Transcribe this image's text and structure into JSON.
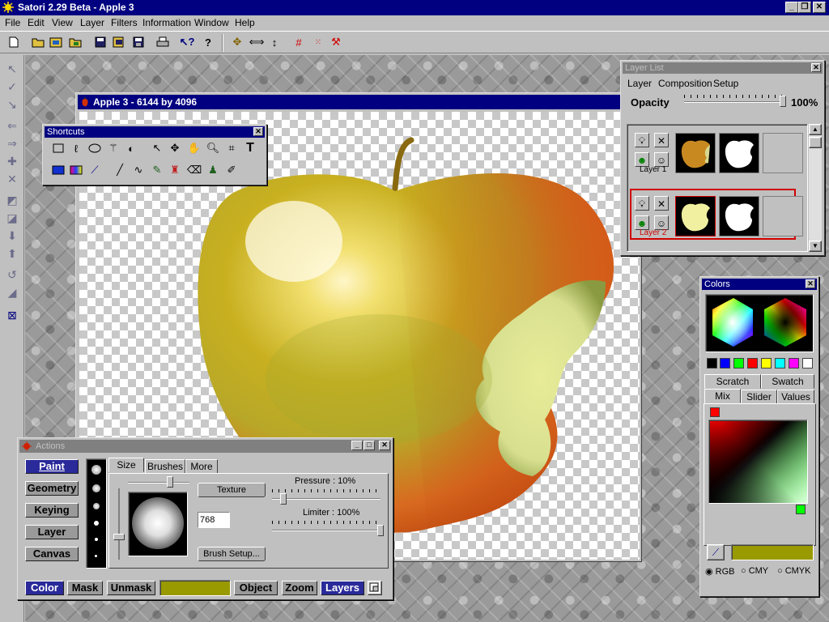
{
  "app": {
    "title": "Satori 2.29 Beta - Apple 3",
    "window_controls": [
      "_",
      "❐",
      "✕"
    ]
  },
  "menu": [
    "File",
    "Edit",
    "View",
    "Layer",
    "Filters",
    "Information",
    "Window",
    "Help"
  ],
  "document": {
    "title": "Apple 3 - 6144 by 4096"
  },
  "shortcuts": {
    "title": "Shortcuts"
  },
  "layer_list": {
    "title": "Layer List",
    "menu": [
      "Layer",
      "Composition",
      "Setup"
    ],
    "opacity_label": "Opacity",
    "opacity_value": "100%",
    "layers": [
      {
        "name": "Layer 1",
        "selected": false
      },
      {
        "name": "Layer 2",
        "selected": true
      }
    ]
  },
  "colors": {
    "title": "Colors",
    "swatches": [
      "#000000",
      "#0000ff",
      "#00ff00",
      "#ff0000",
      "#ffff00",
      "#00ffff",
      "#ff00ff",
      "#ffffff"
    ],
    "tabs_top": [
      "Scratch",
      "Swatch"
    ],
    "tabs_bottom": [
      "Mix",
      "Slider",
      "Values"
    ],
    "current_color": "#999900",
    "modes": [
      "RGB",
      "CMY",
      "CMYK"
    ],
    "selected_mode": "RGB"
  },
  "actions": {
    "title": "Actions",
    "left_buttons": [
      "Paint",
      "Geometry",
      "Keying",
      "Layer",
      "Canvas"
    ],
    "selected_left": "Paint",
    "tabs": [
      "Size",
      "Brushes",
      "More"
    ],
    "texture_label": "Texture",
    "size_value": "768",
    "brush_setup_label": "Brush Setup...",
    "pressure_label": "Pressure : 10%",
    "limiter_label": "Limiter : 100%",
    "bottom_buttons": [
      "Color",
      "Mask",
      "Unmask",
      "Object",
      "Zoom",
      "Layers"
    ]
  }
}
